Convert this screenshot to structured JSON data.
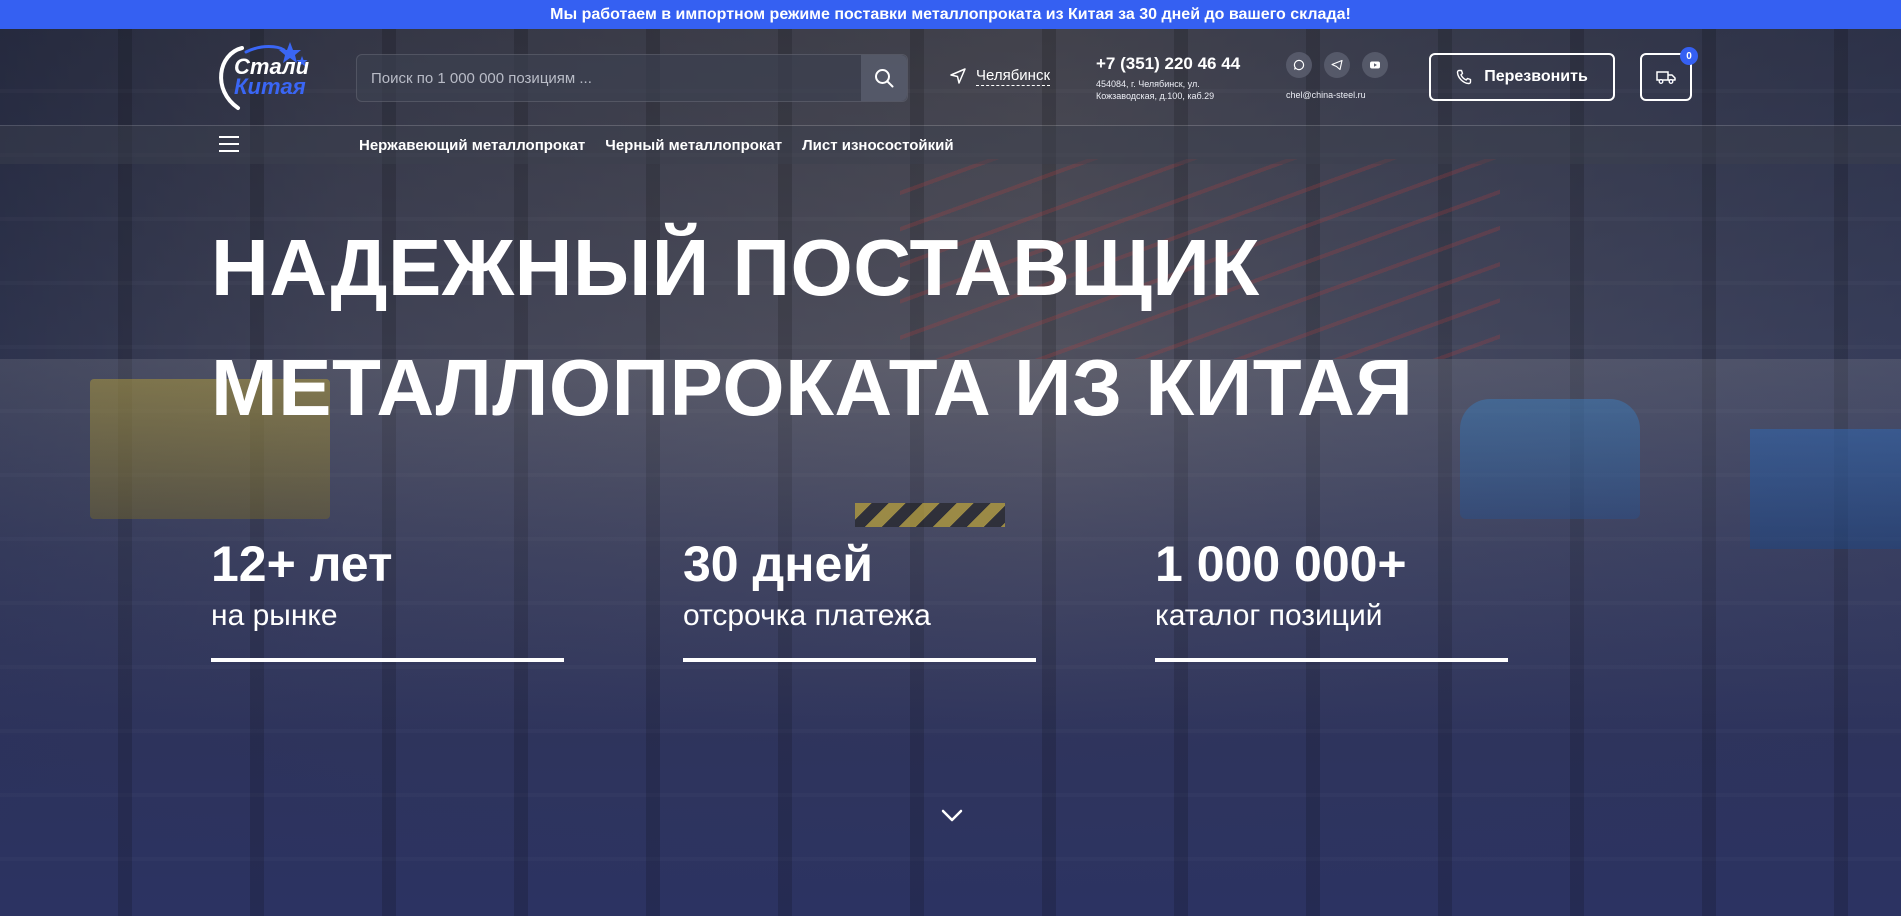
{
  "banner": {
    "text": "Мы работаем в импортном режиме поставки металлопроката из Китая за 30 дней до вашего склада!"
  },
  "logo": {
    "line1": "Стали",
    "line2": "Китая"
  },
  "search": {
    "placeholder": "Поиск по 1 000 000 позициям ..."
  },
  "city": {
    "name": "Челябинск"
  },
  "contacts": {
    "phone": "+7 (351) 220 46 44",
    "address": "454084, г. Челябинск, ул. Кожзаводская, д.100, каб.29",
    "email": "chel@china-steel.ru"
  },
  "socials": [
    {
      "icon": "whatsapp-icon"
    },
    {
      "icon": "telegram-icon"
    },
    {
      "icon": "youtube-icon"
    }
  ],
  "callback": {
    "label": "Перезвонить"
  },
  "cart": {
    "count": "0"
  },
  "nav": {
    "links": [
      "Нержавеющий металлопрокат",
      "Черный металлопрокат",
      "Лист износостойкий"
    ]
  },
  "hero": {
    "headline_line1": "НАДЕЖНЫЙ ПОСТАВЩИК",
    "headline_line2": "МЕТАЛЛОПРОКАТА ИЗ КИТАЯ",
    "stats": [
      {
        "value": "12+ лет",
        "label": "на рынке"
      },
      {
        "value": "30 дней",
        "label": "отсрочка платежа"
      },
      {
        "value": "1 000 000+",
        "label": "каталог позиций"
      }
    ]
  },
  "colors": {
    "accent": "#3560f2",
    "background": "#2c3362",
    "text": "#ffffff"
  }
}
